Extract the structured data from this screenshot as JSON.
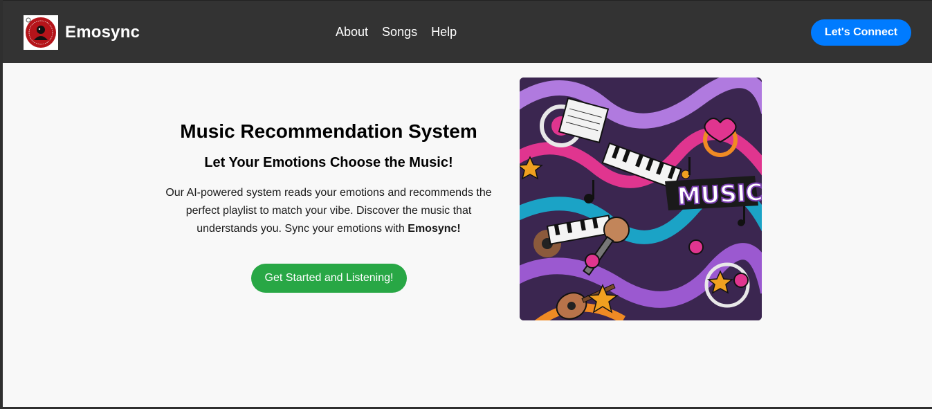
{
  "navbar": {
    "brand_name": "Emosync",
    "logo_icon": "emosync-logo-icon",
    "links": [
      "About",
      "Songs",
      "Help"
    ],
    "connect_label": "Let's Connect"
  },
  "hero": {
    "title": "Music Recommendation System",
    "subtitle": "Let Your Emotions Choose the Music!",
    "description_prefix": "Our AI-powered system reads your emotions and recommends the perfect playlist to match your vibe. Discover the music that understands you. Sync your emotions with ",
    "description_brand": "Emosync!",
    "cta_label": "Get Started and Listening!",
    "image_text": "MUSIC"
  },
  "colors": {
    "navbar_bg": "#333333",
    "page_bg": "#f8f8f8",
    "connect_button": "#007bff",
    "cta_button": "#28a745"
  }
}
